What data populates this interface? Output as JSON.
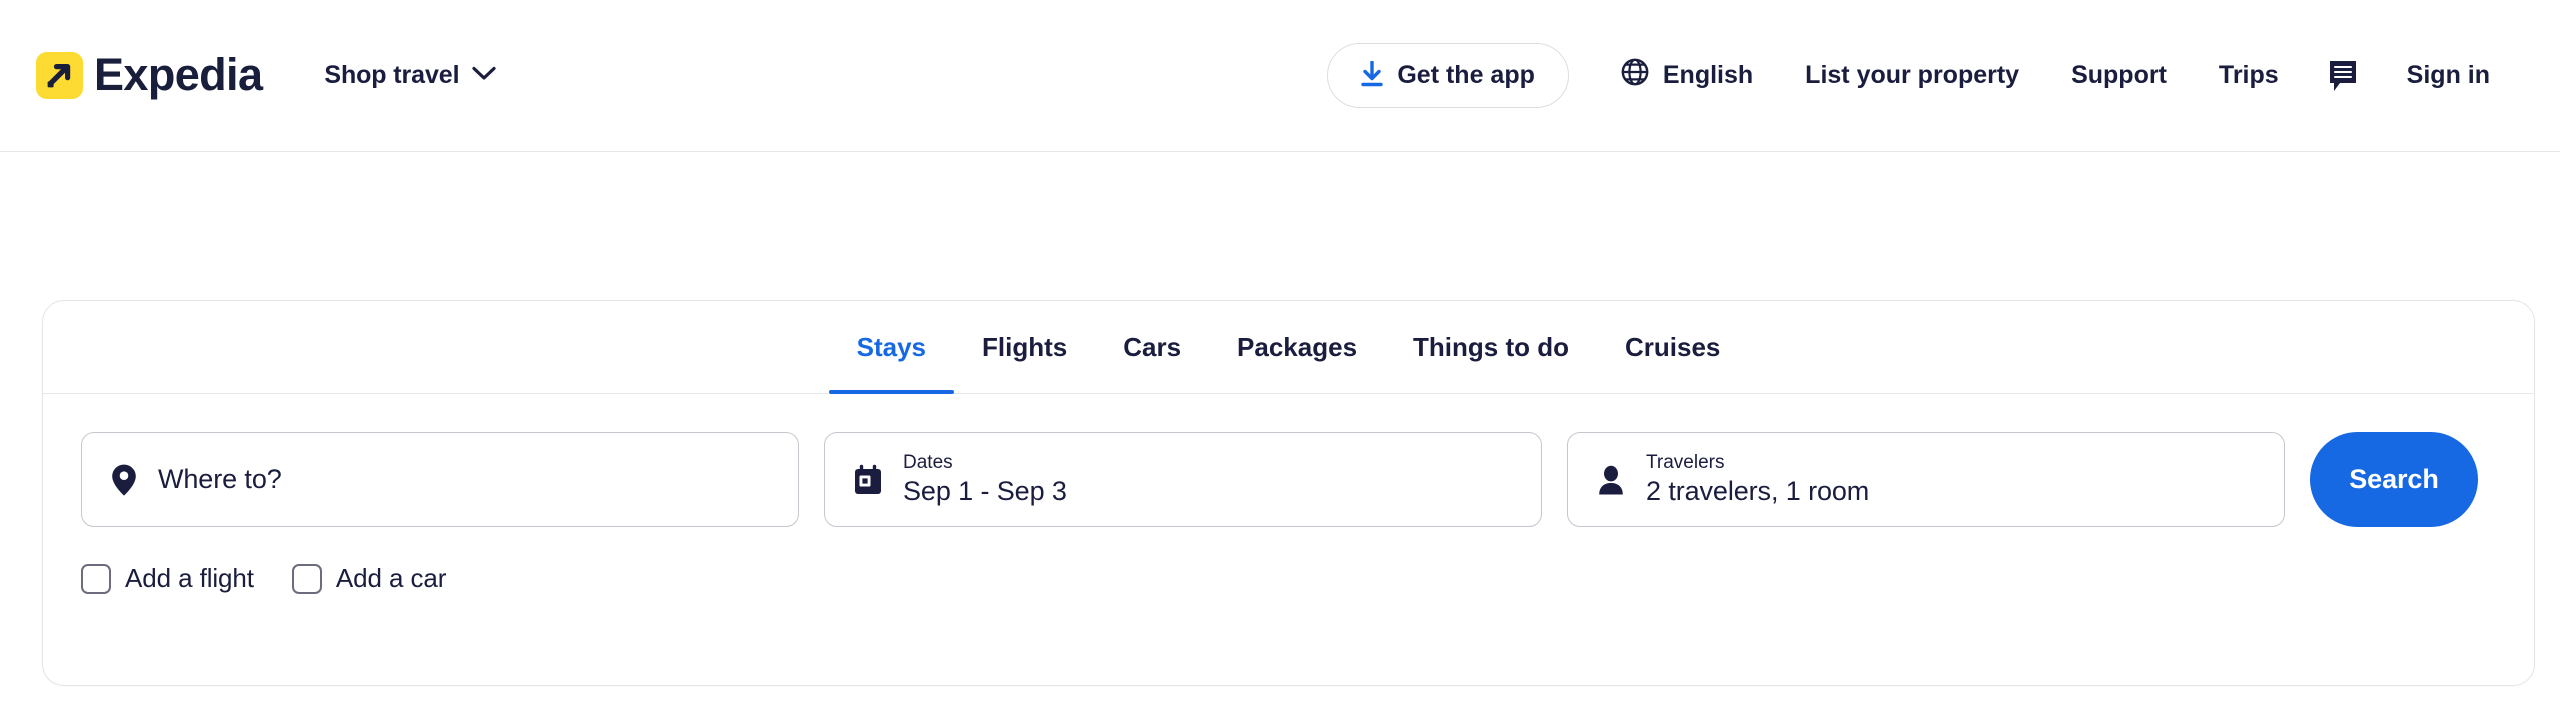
{
  "brand": {
    "name": "Expedia",
    "logo_bg": "#FDDB32",
    "logo_fg": "#191E3B"
  },
  "header": {
    "shop_travel": {
      "label": "Shop travel",
      "chevron_icon": "chevron-down-icon"
    },
    "get_app": {
      "label": "Get the app",
      "icon": "download-icon",
      "icon_color": "#1668E3"
    },
    "language": {
      "label": "English",
      "icon": "globe-icon"
    },
    "links": [
      {
        "label": "List your property"
      },
      {
        "label": "Support"
      },
      {
        "label": "Trips"
      }
    ],
    "chat_icon": "chat-bubble-icon",
    "sign_in": {
      "label": "Sign in"
    }
  },
  "search_card": {
    "tabs": [
      {
        "label": "Stays",
        "active": true
      },
      {
        "label": "Flights",
        "active": false
      },
      {
        "label": "Cars",
        "active": false
      },
      {
        "label": "Packages",
        "active": false
      },
      {
        "label": "Things to do",
        "active": false
      },
      {
        "label": "Cruises",
        "active": false
      }
    ],
    "active_tab_color": "#1668E3",
    "destination": {
      "icon": "location-pin-icon",
      "placeholder": "Where to?",
      "value": ""
    },
    "dates": {
      "icon": "calendar-icon",
      "label": "Dates",
      "value": "Sep 1 - Sep 3"
    },
    "travelers": {
      "icon": "person-icon",
      "label": "Travelers",
      "value": "2 travelers, 1 room"
    },
    "search_button": {
      "label": "Search",
      "color": "#1668E3"
    },
    "options": [
      {
        "label": "Add a flight",
        "checked": false
      },
      {
        "label": "Add a car",
        "checked": false
      }
    ]
  }
}
